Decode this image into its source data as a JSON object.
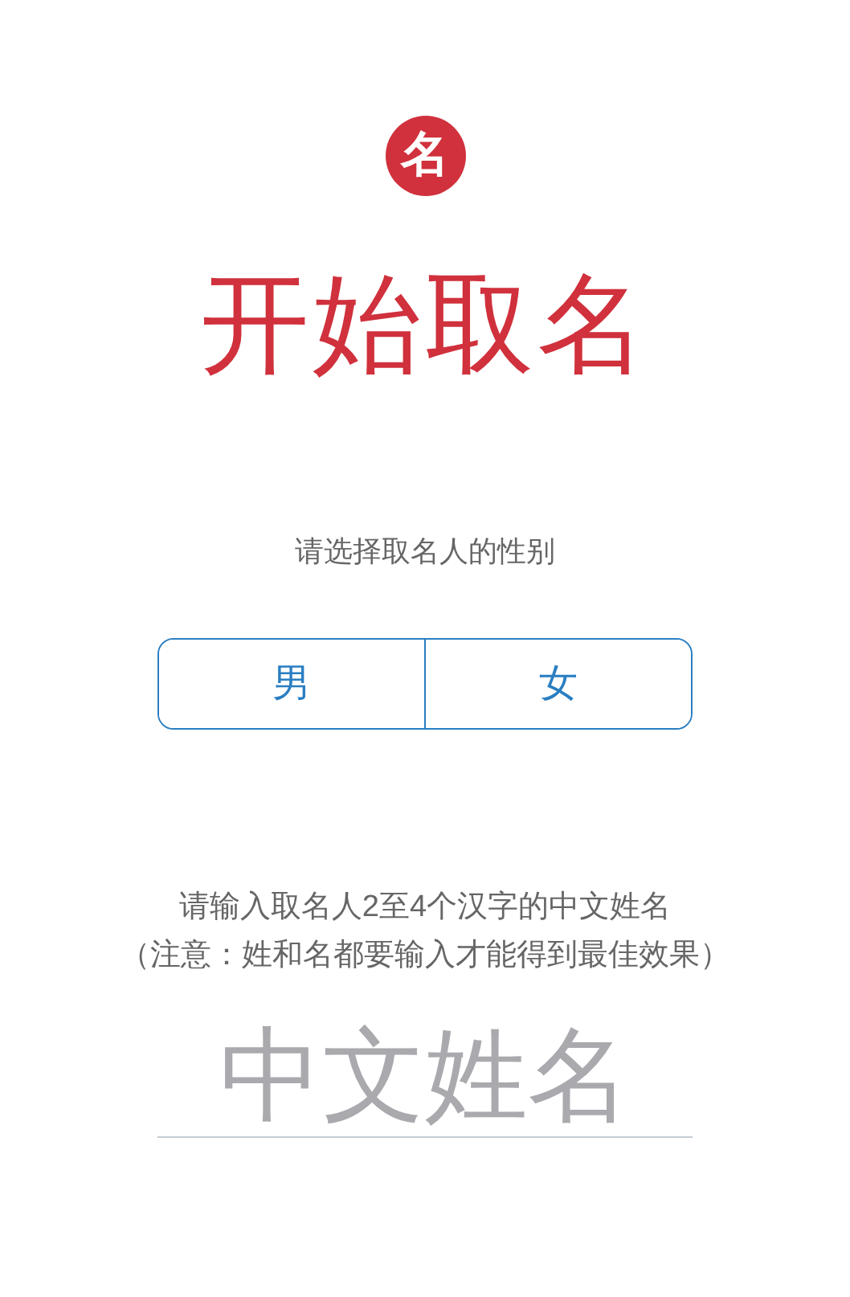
{
  "logo": {
    "text": "名"
  },
  "title": "开始取名",
  "gender_prompt": "请选择取名人的性别",
  "gender_options": [
    {
      "label": "男",
      "selected": false
    },
    {
      "label": "女",
      "selected": false
    }
  ],
  "name_instructions": [
    "请输入取名人2至4个汉字的中文姓名",
    "（注意：姓和名都要输入才能得到最佳效果）"
  ],
  "name_field": {
    "placeholder": "中文姓名"
  }
}
